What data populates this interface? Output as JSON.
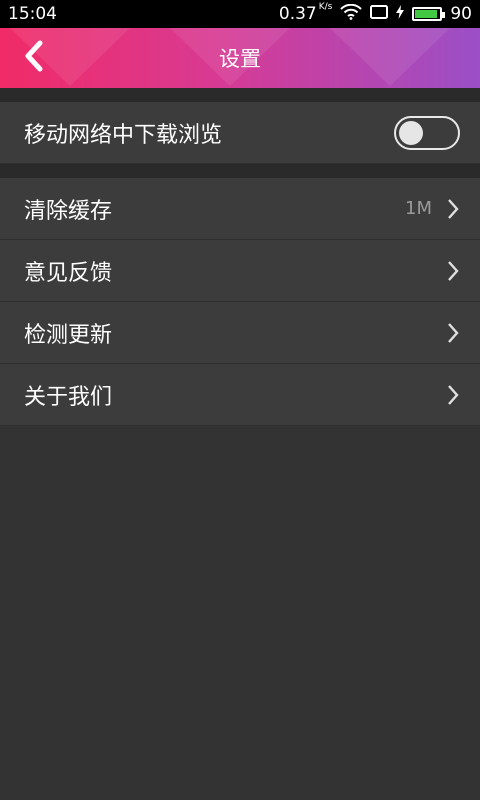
{
  "status_bar": {
    "time": "15:04",
    "net_speed": "0.37",
    "net_unit": "K/s",
    "battery_level": "90",
    "battery_fill_percent": 90,
    "icons": [
      "wifi-icon",
      "screen-icon",
      "charging-icon",
      "battery-icon"
    ]
  },
  "header": {
    "title": "设置",
    "back_icon": "chevron-left-icon",
    "gradient": [
      "#f02b67",
      "#d83a93",
      "#9b4fc7"
    ]
  },
  "settings": {
    "mobile_download": {
      "label": "移动网络中下载浏览",
      "enabled": false
    },
    "items": [
      {
        "label": "清除缓存",
        "value": "1M"
      },
      {
        "label": "意见反馈",
        "value": ""
      },
      {
        "label": "检测更新",
        "value": ""
      },
      {
        "label": "关于我们",
        "value": ""
      }
    ]
  },
  "colors": {
    "background": "#333333",
    "row_background": "#3c3c3c",
    "secondary_text": "#9a9a9a"
  }
}
